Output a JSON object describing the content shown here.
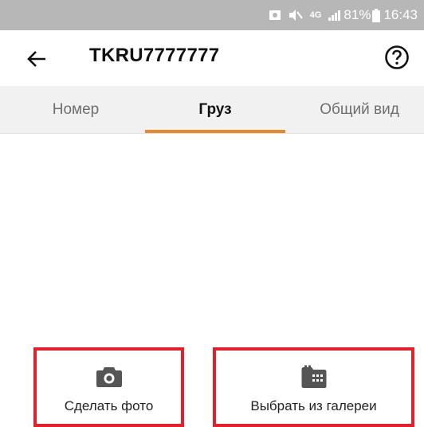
{
  "status_bar": {
    "network": "4G",
    "battery": "81%",
    "time": "16:43"
  },
  "app_bar": {
    "title": "TKRU7777777"
  },
  "tabs": [
    {
      "label": "Номер",
      "active": false
    },
    {
      "label": "Груз",
      "active": true
    },
    {
      "label": "Общий вид",
      "active": false
    }
  ],
  "actions": {
    "take_photo": {
      "label": "Сделать фото",
      "icon": "camera-icon"
    },
    "pick_gallery": {
      "label": "Выбрать из галереи",
      "icon": "gallery-icon"
    }
  },
  "colors": {
    "accent": "#e6892e",
    "highlight_border": "#e0202a",
    "status_bar": "#b7b7b7"
  }
}
